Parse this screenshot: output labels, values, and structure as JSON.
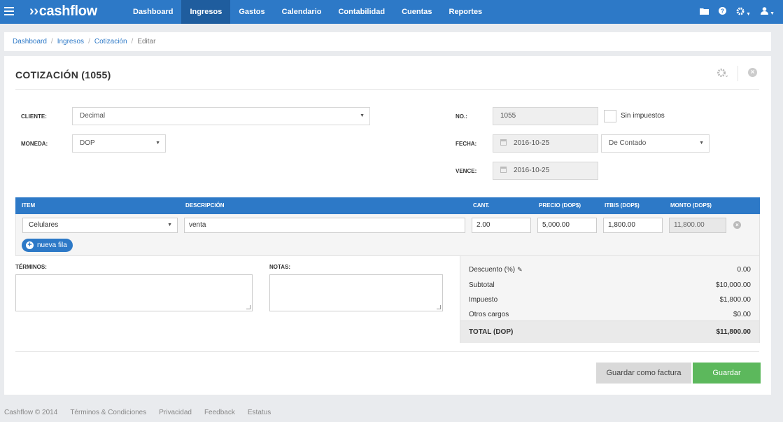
{
  "app": {
    "brand": "cashflow",
    "brand_mark": "››"
  },
  "nav": {
    "items": [
      "Dashboard",
      "Ingresos",
      "Gastos",
      "Calendario",
      "Contabilidad",
      "Cuentas",
      "Reportes"
    ],
    "active": "Ingresos"
  },
  "top_icons": [
    "folder-icon",
    "help-icon",
    "gear-icon",
    "user-icon"
  ],
  "breadcrumb": [
    "Dashboard",
    "Ingresos",
    "Cotización",
    "Editar"
  ],
  "page": {
    "title": "COTIZACIÓN (1055)"
  },
  "form": {
    "cliente_label": "CLIENTE:",
    "cliente_value": "Decimal",
    "moneda_label": "MONEDA:",
    "moneda_value": "DOP",
    "no_label": "NO.:",
    "no_value": "1055",
    "sin_impuestos_label": "Sin impuestos",
    "fecha_label": "FECHA:",
    "fecha_value": "2016-10-25",
    "payment_term": "De Contado",
    "vence_label": "VENCE:",
    "vence_value": "2016-10-25"
  },
  "table": {
    "headers": [
      "ITEM",
      "DESCRIPCIÓN",
      "CANT.",
      "PRECIO (DOP$)",
      "ITBIS (DOP$)",
      "MONTO (DOP$)"
    ],
    "row": {
      "item": "Celulares",
      "descripcion": "venta",
      "cant": "2.00",
      "precio": "5,000.00",
      "itbis": "1,800.00",
      "monto": "11,800.00"
    },
    "new_row_label": "nueva fila"
  },
  "notes": {
    "terminos_label": "TÉRMINOS:",
    "notas_label": "NOTAS:"
  },
  "totals": {
    "descuento_label": "Descuento (%)",
    "descuento_value": "0.00",
    "subtotal_label": "Subtotal",
    "subtotal_value": "$10,000.00",
    "impuesto_label": "Impuesto",
    "impuesto_value": "$1,800.00",
    "otros_label": "Otros cargos",
    "otros_value": "$0.00",
    "total_label": "TOTAL (DOP)",
    "total_value": "$11,800.00"
  },
  "actions": {
    "save_as_invoice": "Guardar como factura",
    "save": "Guardar"
  },
  "footer": [
    "Cashflow © 2014",
    "Términos & Condiciones",
    "Privacidad",
    "Feedback",
    "Estatus"
  ],
  "colors": {
    "primary": "#2d79c7",
    "nav_active": "#1f5d9e",
    "success": "#5cb85c"
  }
}
